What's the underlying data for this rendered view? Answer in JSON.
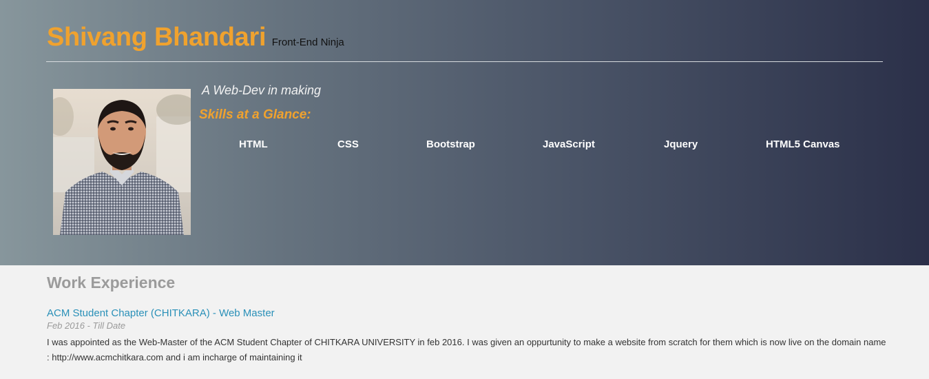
{
  "header": {
    "name": "Shivang Bhandari",
    "tagline": "Front-End Ninja",
    "subtitle": "A Web-Dev in making",
    "skills_heading": "Skills at a Glance:",
    "skills": [
      "HTML",
      "CSS",
      "Bootstrap",
      "JavaScript",
      "Jquery",
      "HTML5 Canvas"
    ]
  },
  "work": {
    "title": "Work Experience",
    "jobs": [
      {
        "title": "ACM Student Chapter (CHITKARA) - Web Master",
        "date": "Feb 2016 - Till Date",
        "description": "I was appointed as the Web-Master of the ACM Student Chapter of CHITKARA UNIVERSITY in feb 2016. I was given an oppurtunity to make a website from scratch for them which is now live on the domain name : http://www.acmchitkara.com and i am incharge of maintaining it"
      }
    ]
  },
  "colors": {
    "accent": "#f0a22e",
    "link": "#2a90b8",
    "header_gradient_start": "#87969c",
    "header_gradient_end": "#2b3049",
    "page_background": "#f2f2f2"
  }
}
